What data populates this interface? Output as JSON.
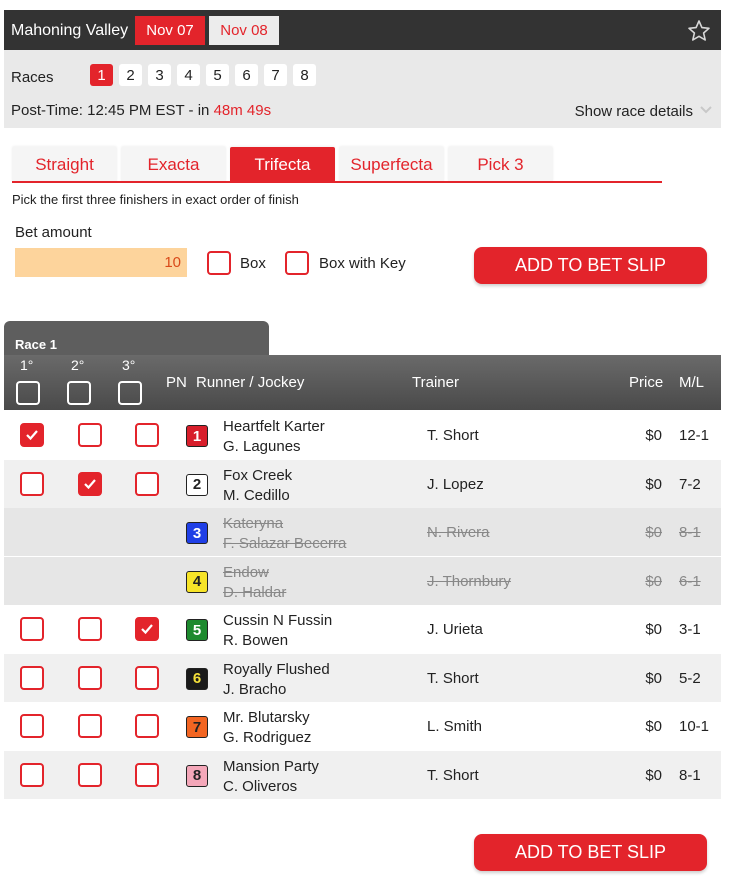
{
  "header": {
    "track": "Mahoning Valley",
    "dates": [
      "Nov 07",
      "Nov 08"
    ],
    "active_date": "Nov 07"
  },
  "info": {
    "races_label": "Races",
    "races": [
      "1",
      "2",
      "3",
      "4",
      "5",
      "6",
      "7",
      "8"
    ],
    "active_race": "1",
    "posttime_prefix": "Post-Time: 12:45 PM EST - in ",
    "countdown": "48m 49s",
    "details_link": "Show race details"
  },
  "bet_types": [
    "Straight",
    "Exacta",
    "Trifecta",
    "Superfecta",
    "Pick 3"
  ],
  "active_bet_type": "Trifecta",
  "instructions": "Pick the first three finishers in exact order of finish",
  "bet": {
    "amount_label": "Bet amount",
    "amount": "10",
    "box_label": "Box",
    "box_key_label": "Box with Key",
    "add_label": "ADD TO BET SLIP"
  },
  "race": {
    "title": "Race 1",
    "positions": [
      "1°",
      "2°",
      "3°"
    ],
    "columns": {
      "pn": "PN",
      "runner": "Runner / Jockey",
      "trainer": "Trainer",
      "price": "Price",
      "ml": "M/L"
    },
    "entries": [
      {
        "pn": "1",
        "runner": "Heartfelt Karter",
        "jockey": "G. Lagunes",
        "trainer": "T. Short",
        "price": "$0",
        "ml": "12-1",
        "scratched": false,
        "picks": [
          true,
          false,
          false
        ],
        "pn_bg": "#d81e2b",
        "pn_fg": "#ffffff"
      },
      {
        "pn": "2",
        "runner": "Fox Creek",
        "jockey": "M. Cedillo",
        "trainer": "J. Lopez",
        "price": "$0",
        "ml": "7-2",
        "scratched": false,
        "picks": [
          false,
          true,
          false
        ],
        "pn_bg": "#ffffff",
        "pn_fg": "#222222"
      },
      {
        "pn": "3",
        "runner": "Kateryna",
        "jockey": "F. Salazar Becerra",
        "trainer": "N. Rivera",
        "price": "$0",
        "ml": "8-1",
        "scratched": true,
        "picks": [
          false,
          false,
          false
        ],
        "pn_bg": "#1f3fe6",
        "pn_fg": "#ffffff"
      },
      {
        "pn": "4",
        "runner": "Endow",
        "jockey": "D. Haldar",
        "trainer": "J. Thornbury",
        "price": "$0",
        "ml": "6-1",
        "scratched": true,
        "picks": [
          false,
          false,
          false
        ],
        "pn_bg": "#f7e428",
        "pn_fg": "#222222"
      },
      {
        "pn": "5",
        "runner": "Cussin N Fussin",
        "jockey": "R. Bowen",
        "trainer": "J. Urieta",
        "price": "$0",
        "ml": "3-1",
        "scratched": false,
        "picks": [
          false,
          false,
          true
        ],
        "pn_bg": "#1d8a2e",
        "pn_fg": "#ffffff"
      },
      {
        "pn": "6",
        "runner": "Royally Flushed",
        "jockey": "J. Bracho",
        "trainer": "T. Short",
        "price": "$0",
        "ml": "5-2",
        "scratched": false,
        "picks": [
          false,
          false,
          false
        ],
        "pn_bg": "#1a1a1a",
        "pn_fg": "#f5e13a"
      },
      {
        "pn": "7",
        "runner": "Mr. Blutarsky",
        "jockey": "G. Rodriguez",
        "trainer": "L. Smith",
        "price": "$0",
        "ml": "10-1",
        "scratched": false,
        "picks": [
          false,
          false,
          false
        ],
        "pn_bg": "#f26522",
        "pn_fg": "#222222"
      },
      {
        "pn": "8",
        "runner": "Mansion Party",
        "jockey": "C. Oliveros",
        "trainer": "T. Short",
        "price": "$0",
        "ml": "8-1",
        "scratched": false,
        "picks": [
          false,
          false,
          false
        ],
        "pn_bg": "#f4a7b9",
        "pn_fg": "#222222"
      }
    ]
  },
  "colors": {
    "accent": "#e3242b",
    "input_bg": "#fdd49c",
    "header_bg": "#333333"
  }
}
